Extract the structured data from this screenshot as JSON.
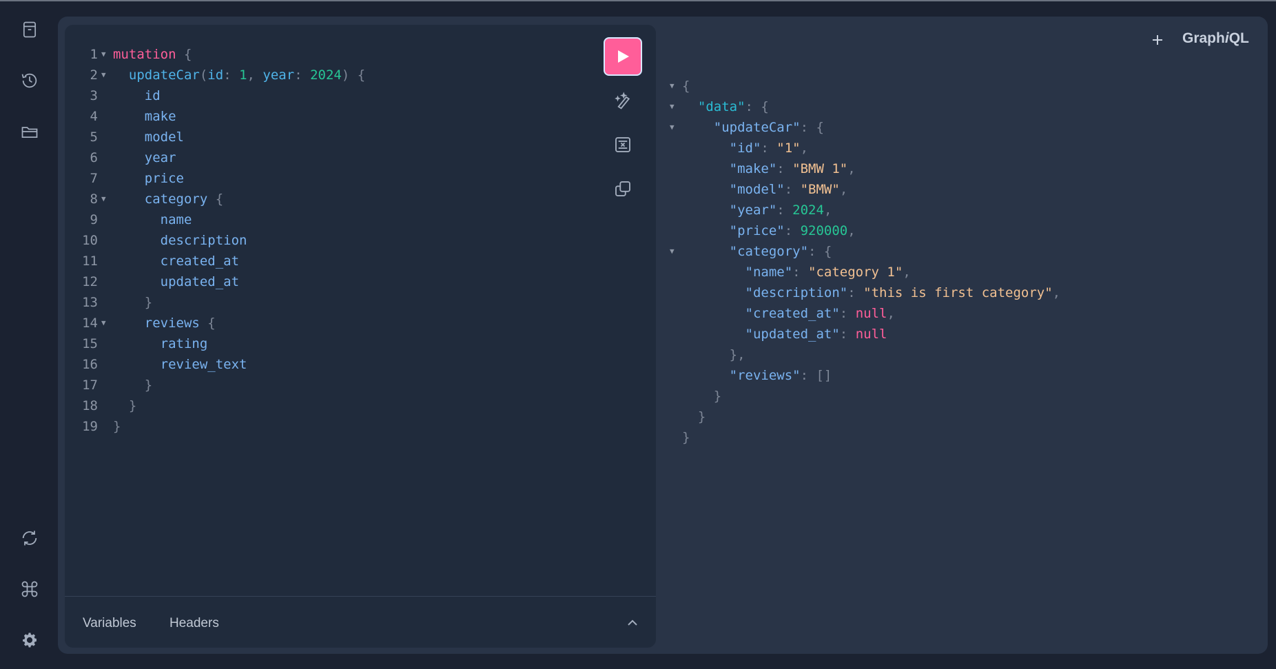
{
  "app": {
    "logo_pre": "Graph",
    "logo_i": "i",
    "logo_post": "QL"
  },
  "sidebar": {
    "top_icons": [
      "docs-icon",
      "history-icon",
      "explorer-icon"
    ],
    "bottom_icons": [
      "refetch-schema-icon",
      "shortcuts-icon",
      "settings-icon"
    ]
  },
  "editor": {
    "lines": [
      {
        "n": "1",
        "fold": true,
        "tokens": [
          {
            "t": "kw",
            "v": "mutation"
          },
          {
            "t": "pun",
            "v": " {"
          }
        ]
      },
      {
        "n": "2",
        "fold": true,
        "tokens": [
          {
            "t": "sp",
            "v": "  "
          },
          {
            "t": "fn",
            "v": "updateCar"
          },
          {
            "t": "pun",
            "v": "("
          },
          {
            "t": "fn",
            "v": "id"
          },
          {
            "t": "pun",
            "v": ": "
          },
          {
            "t": "num",
            "v": "1"
          },
          {
            "t": "pun",
            "v": ", "
          },
          {
            "t": "fn",
            "v": "year"
          },
          {
            "t": "pun",
            "v": ": "
          },
          {
            "t": "num",
            "v": "2024"
          },
          {
            "t": "pun",
            "v": ") {"
          }
        ]
      },
      {
        "n": "3",
        "fold": false,
        "tokens": [
          {
            "t": "sp",
            "v": "    "
          },
          {
            "t": "fld",
            "v": "id"
          }
        ]
      },
      {
        "n": "4",
        "fold": false,
        "tokens": [
          {
            "t": "sp",
            "v": "    "
          },
          {
            "t": "fld",
            "v": "make"
          }
        ]
      },
      {
        "n": "5",
        "fold": false,
        "tokens": [
          {
            "t": "sp",
            "v": "    "
          },
          {
            "t": "fld",
            "v": "model"
          }
        ]
      },
      {
        "n": "6",
        "fold": false,
        "tokens": [
          {
            "t": "sp",
            "v": "    "
          },
          {
            "t": "fld",
            "v": "year"
          }
        ]
      },
      {
        "n": "7",
        "fold": false,
        "tokens": [
          {
            "t": "sp",
            "v": "    "
          },
          {
            "t": "fld",
            "v": "price"
          }
        ]
      },
      {
        "n": "8",
        "fold": true,
        "tokens": [
          {
            "t": "sp",
            "v": "    "
          },
          {
            "t": "fld",
            "v": "category"
          },
          {
            "t": "pun",
            "v": " {"
          }
        ]
      },
      {
        "n": "9",
        "fold": false,
        "tokens": [
          {
            "t": "sp",
            "v": "      "
          },
          {
            "t": "fld",
            "v": "name"
          }
        ]
      },
      {
        "n": "10",
        "fold": false,
        "tokens": [
          {
            "t": "sp",
            "v": "      "
          },
          {
            "t": "fld",
            "v": "description"
          }
        ]
      },
      {
        "n": "11",
        "fold": false,
        "tokens": [
          {
            "t": "sp",
            "v": "      "
          },
          {
            "t": "fld",
            "v": "created_at"
          }
        ]
      },
      {
        "n": "12",
        "fold": false,
        "tokens": [
          {
            "t": "sp",
            "v": "      "
          },
          {
            "t": "fld",
            "v": "updated_at"
          }
        ]
      },
      {
        "n": "13",
        "fold": false,
        "tokens": [
          {
            "t": "sp",
            "v": "    "
          },
          {
            "t": "pun",
            "v": "}"
          }
        ]
      },
      {
        "n": "14",
        "fold": true,
        "tokens": [
          {
            "t": "sp",
            "v": "    "
          },
          {
            "t": "fld",
            "v": "reviews"
          },
          {
            "t": "pun",
            "v": " {"
          }
        ]
      },
      {
        "n": "15",
        "fold": false,
        "tokens": [
          {
            "t": "sp",
            "v": "      "
          },
          {
            "t": "fld",
            "v": "rating"
          }
        ]
      },
      {
        "n": "16",
        "fold": false,
        "tokens": [
          {
            "t": "sp",
            "v": "      "
          },
          {
            "t": "fld",
            "v": "review_text"
          }
        ]
      },
      {
        "n": "17",
        "fold": false,
        "tokens": [
          {
            "t": "sp",
            "v": "    "
          },
          {
            "t": "pun",
            "v": "}"
          }
        ]
      },
      {
        "n": "18",
        "fold": false,
        "tokens": [
          {
            "t": "sp",
            "v": "  "
          },
          {
            "t": "pun",
            "v": "}"
          }
        ]
      },
      {
        "n": "19",
        "fold": false,
        "tokens": [
          {
            "t": "pun",
            "v": "}"
          }
        ]
      }
    ],
    "toolbar_icons": [
      "prettify-icon",
      "merge-fragments-icon",
      "copy-icon"
    ]
  },
  "bottom_tabs": {
    "variables": "Variables",
    "headers": "Headers"
  },
  "result": {
    "lines": [
      {
        "fold": true,
        "tokens": [
          {
            "t": "pun",
            "v": "{"
          }
        ]
      },
      {
        "fold": true,
        "tokens": [
          {
            "t": "sp",
            "v": "  "
          },
          {
            "t": "key0",
            "v": "\"data\""
          },
          {
            "t": "pun",
            "v": ": {"
          }
        ]
      },
      {
        "fold": true,
        "tokens": [
          {
            "t": "sp",
            "v": "    "
          },
          {
            "t": "key",
            "v": "\"updateCar\""
          },
          {
            "t": "pun",
            "v": ": {"
          }
        ]
      },
      {
        "fold": false,
        "tokens": [
          {
            "t": "sp",
            "v": "      "
          },
          {
            "t": "key",
            "v": "\"id\""
          },
          {
            "t": "pun",
            "v": ": "
          },
          {
            "t": "str",
            "v": "\"1\""
          },
          {
            "t": "pun",
            "v": ","
          }
        ]
      },
      {
        "fold": false,
        "tokens": [
          {
            "t": "sp",
            "v": "      "
          },
          {
            "t": "key",
            "v": "\"make\""
          },
          {
            "t": "pun",
            "v": ": "
          },
          {
            "t": "str",
            "v": "\"BMW 1\""
          },
          {
            "t": "pun",
            "v": ","
          }
        ]
      },
      {
        "fold": false,
        "tokens": [
          {
            "t": "sp",
            "v": "      "
          },
          {
            "t": "key",
            "v": "\"model\""
          },
          {
            "t": "pun",
            "v": ": "
          },
          {
            "t": "str",
            "v": "\"BMW\""
          },
          {
            "t": "pun",
            "v": ","
          }
        ]
      },
      {
        "fold": false,
        "tokens": [
          {
            "t": "sp",
            "v": "      "
          },
          {
            "t": "key",
            "v": "\"year\""
          },
          {
            "t": "pun",
            "v": ": "
          },
          {
            "t": "num",
            "v": "2024"
          },
          {
            "t": "pun",
            "v": ","
          }
        ]
      },
      {
        "fold": false,
        "tokens": [
          {
            "t": "sp",
            "v": "      "
          },
          {
            "t": "key",
            "v": "\"price\""
          },
          {
            "t": "pun",
            "v": ": "
          },
          {
            "t": "num",
            "v": "920000"
          },
          {
            "t": "pun",
            "v": ","
          }
        ]
      },
      {
        "fold": true,
        "tokens": [
          {
            "t": "sp",
            "v": "      "
          },
          {
            "t": "key",
            "v": "\"category\""
          },
          {
            "t": "pun",
            "v": ": {"
          }
        ]
      },
      {
        "fold": false,
        "tokens": [
          {
            "t": "sp",
            "v": "        "
          },
          {
            "t": "key",
            "v": "\"name\""
          },
          {
            "t": "pun",
            "v": ": "
          },
          {
            "t": "str",
            "v": "\"category 1\""
          },
          {
            "t": "pun",
            "v": ","
          }
        ]
      },
      {
        "fold": false,
        "tokens": [
          {
            "t": "sp",
            "v": "        "
          },
          {
            "t": "key",
            "v": "\"description\""
          },
          {
            "t": "pun",
            "v": ": "
          },
          {
            "t": "str",
            "v": "\"this is first category\""
          },
          {
            "t": "pun",
            "v": ","
          }
        ]
      },
      {
        "fold": false,
        "tokens": [
          {
            "t": "sp",
            "v": "        "
          },
          {
            "t": "key",
            "v": "\"created_at\""
          },
          {
            "t": "pun",
            "v": ": "
          },
          {
            "t": "nul",
            "v": "null"
          },
          {
            "t": "pun",
            "v": ","
          }
        ]
      },
      {
        "fold": false,
        "tokens": [
          {
            "t": "sp",
            "v": "        "
          },
          {
            "t": "key",
            "v": "\"updated_at\""
          },
          {
            "t": "pun",
            "v": ": "
          },
          {
            "t": "nul",
            "v": "null"
          }
        ]
      },
      {
        "fold": false,
        "tokens": [
          {
            "t": "sp",
            "v": "      "
          },
          {
            "t": "pun",
            "v": "},"
          }
        ]
      },
      {
        "fold": false,
        "tokens": [
          {
            "t": "sp",
            "v": "      "
          },
          {
            "t": "key",
            "v": "\"reviews\""
          },
          {
            "t": "pun",
            "v": ": []"
          }
        ]
      },
      {
        "fold": false,
        "tokens": [
          {
            "t": "sp",
            "v": "    "
          },
          {
            "t": "pun",
            "v": "}"
          }
        ]
      },
      {
        "fold": false,
        "tokens": [
          {
            "t": "sp",
            "v": "  "
          },
          {
            "t": "pun",
            "v": "}"
          }
        ]
      },
      {
        "fold": false,
        "tokens": [
          {
            "t": "pun",
            "v": "}"
          }
        ]
      }
    ]
  },
  "colors": {
    "run_button": "#ff5e99",
    "keyword": "#ff5e99",
    "field": "#7ab3f0",
    "number": "#27c695",
    "string": "#f2c192"
  }
}
